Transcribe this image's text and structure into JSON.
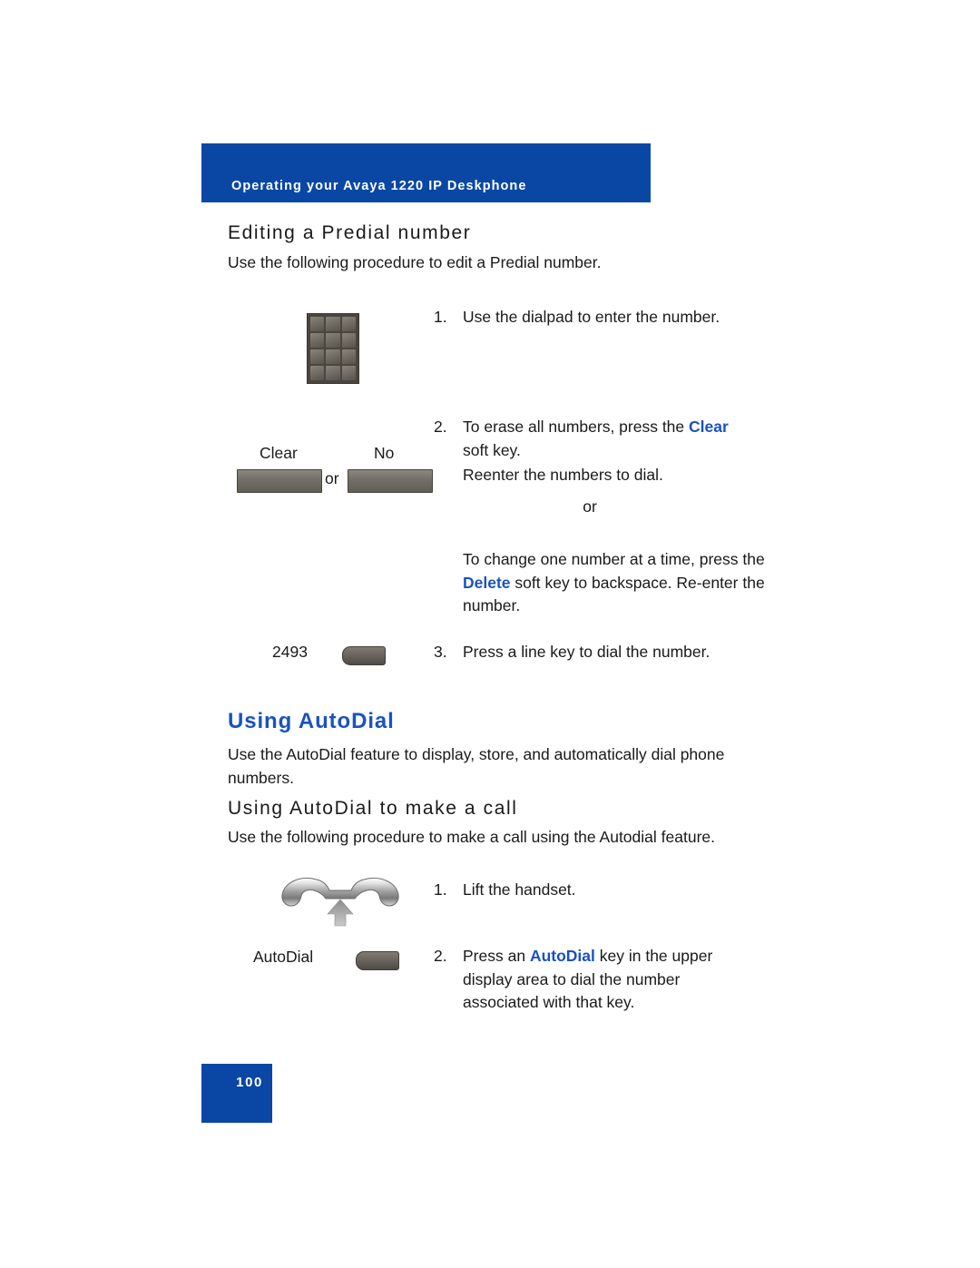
{
  "header": {
    "banner_title": "Operating your Avaya 1220 IP Deskphone",
    "banner_color": "#0a47a5"
  },
  "accent_colors": {
    "heading_blue": "#1a52c0",
    "banner_blue": "#0a47a5",
    "key_gray": "#6e6960"
  },
  "sections": [
    {
      "id": "editing-predial",
      "heading": "Editing a Predial number",
      "intro": "Use the following procedure to edit a Predial number.",
      "steps": [
        {
          "number": "1.",
          "text": "Use the dialpad to enter the number."
        },
        {
          "number": "2.",
          "text_before": "To erase all numbers, press the ",
          "term": "Clear",
          "text_after": " soft key."
        },
        {
          "number": "3.",
          "text": "Press a line key to dial the number."
        }
      ],
      "step2_extra": {
        "reenter": "Reenter the numbers to dial.",
        "or": "or",
        "change_before": "To change one number at a time, press the ",
        "change_term": "Delete",
        "change_after": " soft key to backspace. Re-enter the number."
      },
      "graphics": {
        "dialpad_label": "",
        "softkey_left_caption": "Clear",
        "softkey_right_caption": "No",
        "softkey_separator": "or",
        "linekey_caption": "2493"
      }
    },
    {
      "id": "using-autodial",
      "heading": "Using AutoDial",
      "intro": "Use the AutoDial feature to display, store, and automatically dial phone numbers.",
      "subheading": "Using AutoDial to make a call",
      "sub_intro": "Use the following procedure to make a call using the Autodial feature.",
      "steps": [
        {
          "number": "1.",
          "text": "Lift the handset."
        },
        {
          "number": "2.",
          "text_before": "Press an ",
          "term": "AutoDial",
          "text_after": " key in the upper display area to dial the number associated with that key."
        }
      ],
      "graphics": {
        "handset_icon": "handset-lift-icon",
        "autodial_caption": "AutoDial"
      }
    }
  ],
  "footer": {
    "page_number": "100"
  }
}
